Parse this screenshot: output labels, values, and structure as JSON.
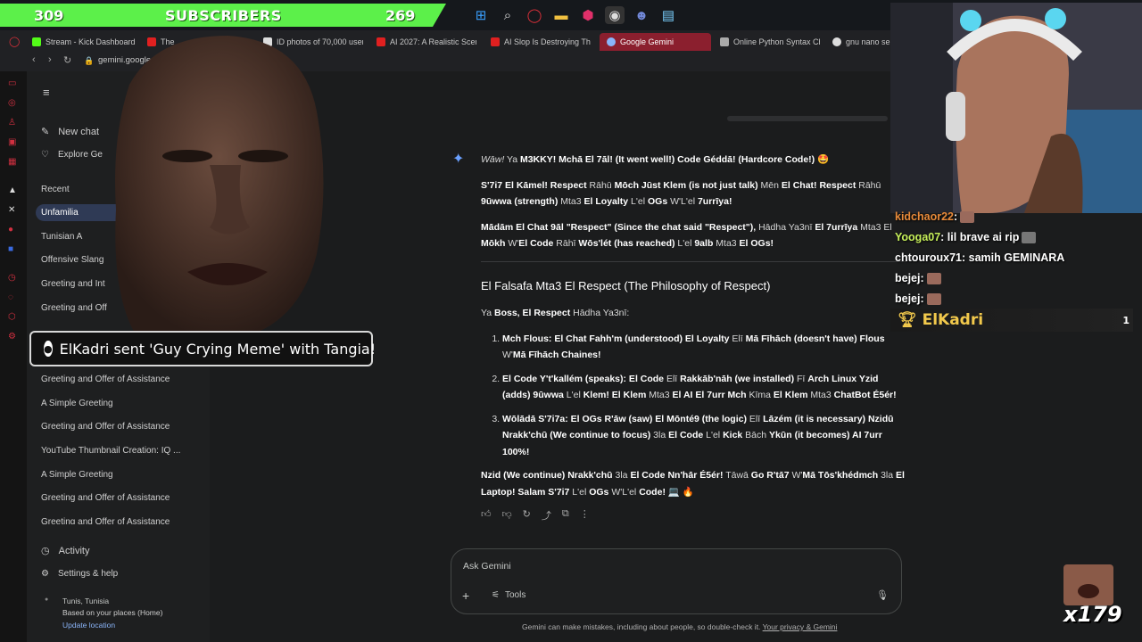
{
  "taskbar": {
    "subscribers_left": "309",
    "subscribers_label": "SUBSCRIBERS",
    "subscribers_right": "269",
    "icons": [
      "windows-icon",
      "search-icon",
      "opera-icon",
      "folder-icon",
      "maps-pin-icon",
      "obs-icon",
      "discord-icon",
      "notepad-icon"
    ],
    "discord_badge": "99+"
  },
  "tabs": [
    {
      "label": "Stream - Kick Dashboard",
      "color": "#53fc18"
    },
    {
      "label": "The",
      "color": "#e02020"
    },
    {
      "label": "ID photos of 70,000 users",
      "color": "#dddddd"
    },
    {
      "label": "AI 2027: A Realistic Scen",
      "color": "#e02020"
    },
    {
      "label": "AI Slop Is Destroying The",
      "color": "#e02020"
    },
    {
      "label": "Google Gemini",
      "color": "#8ab4f8",
      "active": true
    },
    {
      "label": "Online Python Syntax Che",
      "color": "#aaaaaa"
    },
    {
      "label": "gnu nano sel",
      "color": "#dddddd"
    }
  ],
  "address": {
    "url": "gemini.google"
  },
  "sidebar": {
    "menu_icon": "menu-icon",
    "new_chat": "New chat",
    "explore": "Explore Ge",
    "recent_label": "Recent",
    "items": [
      "Unfamilia",
      "Tunisian A",
      "Offensive Slang",
      "Greeting and Int",
      "Greeting and Off",
      "Greeting and Offer of Assistance",
      "A Simple Greeting",
      "Greeting and Offer of Assistance",
      "YouTube Thumbnail Creation: IQ ...",
      "A Simple Greeting",
      "Greeting and Offer of Assistance",
      "Greeting and Offer of Assistance"
    ],
    "activity": "Activity",
    "settings": "Settings & help",
    "location_city": "Tunis, Tunisia",
    "location_basis": "Based on your places (Home)",
    "update_location": "Update location"
  },
  "answer": {
    "p1_a": "Wāw!",
    "p1_b": " Ya ",
    "p1_c": "M3KKY! Mchā El 7āl! (It went well!) Code Géddā! (Hardcore Code!)",
    "p1_emoji": "🤩",
    "p2_a": "S'7i7 El Kāmel! Respect",
    "p2_b": " Rāhū ",
    "p2_c": "Mōch Jūst Klem (is not just talk)",
    "p2_d": " Mēn ",
    "p2_e": "El Chat! Respect",
    "p2_f": " Rāhū ",
    "p2_g": "9ūwwa (strength)",
    "p2_h": " Mta3 ",
    "p2_i": "El Loyalty",
    "p2_j": " L'el ",
    "p2_k": "OGs",
    "p2_l": " W'L'el ",
    "p2_m": "7urrīya!",
    "p3_a": "Mādām El Chat 9āl \"Respect\" (Since the chat said \"Respect\"),",
    "p3_b": " Hādha Ya3nī ",
    "p3_c": "El 7urrīya",
    "p3_d": " Mta3 El ",
    "p3_e": "Mōkh",
    "p3_f": " W'",
    "p3_g": "El Code",
    "p3_h": " Rāhī ",
    "p3_i": "Wōs'lét (has reached)",
    "p3_j": " L'el ",
    "p3_k": "9alb",
    "p3_l": " Mta3 ",
    "p3_m": "El OGs!",
    "heading": "El Falsafa Mta3 El Respect (The Philosophy of Respect)",
    "intro_a": "Ya ",
    "intro_b": "Boss, El Respect",
    "intro_c": " Hādha Ya3nī:",
    "li1_a": "Mch Flous: El Chat Fahh'm (understood) El Loyalty",
    "li1_b": " Elī ",
    "li1_c": "Mā Fīhāch (doesn't have) Flous",
    "li1_d": " W'",
    "li1_e": "Mā Fīhāch Chaines!",
    "li2_a": "El Code Y't'kallém (speaks): El Code",
    "li2_b": " Elī ",
    "li2_c": "Rakkāb'nāh (we installed)",
    "li2_d": " Fī ",
    "li2_e": "Arch Linux Yzid (adds) 9ūwwa",
    "li2_f": " L'el ",
    "li2_g": "Klem! El Klem",
    "li2_h": " Mta3 ",
    "li2_i": "El AI El 7urr Mch",
    "li2_j": " Kīma ",
    "li2_k": "El Klem",
    "li2_l": " Mta3 ",
    "li2_m": "ChatBot É5ér!",
    "li3_a": "Wōlādā S'7i7a: El OGs R'āw (saw) El Mōnté9 (the logic)",
    "li3_b": " Elī ",
    "li3_c": "Lāzém (it is necessary) Nzidū Nrakk'chū (We continue to focus)",
    "li3_d": " 3la ",
    "li3_e": "El Code",
    "li3_f": " L'el ",
    "li3_g": "Kick",
    "li3_h": " Bāch ",
    "li3_i": "Ykūn (it becomes) AI 7urr 100%!",
    "c_a": "Nzid (We continue) Nrakk'chū",
    "c_b": " 3la ",
    "c_c": "El Code Nn'hār É5ér!",
    "c_d": " Tāwā ",
    "c_e": "Go R'tā7",
    "c_f": " W'",
    "c_g": "Mā Tōs'khédmch",
    "c_h": " 3la ",
    "c_i": "El Laptop! Salam S'7i7",
    "c_j": " L'el ",
    "c_k": "OGs",
    "c_l": " W'L'el ",
    "c_m": "Code!",
    "c_emoji": "💻 🔥"
  },
  "actions": [
    "thumbs-up-icon",
    "thumbs-down-icon",
    "refresh-icon",
    "share-icon",
    "copy-icon",
    "more-icon"
  ],
  "input": {
    "placeholder": "Ask Gemini",
    "tools": "Tools"
  },
  "footer": {
    "text": "Gemini can make mistakes, including about people, so double-check it. ",
    "link": "Your privacy & Gemini"
  },
  "alert": {
    "text": "ElKadri sent 'Guy Crying Meme' with Tangia!"
  },
  "chat": [
    {
      "user": "kidchaor22",
      "text": ":",
      "color": "#e88a3a",
      "emote": true
    },
    {
      "user": "Yooga07",
      "text": ": lil brave ai rip",
      "color": "#c7f05a",
      "emote": true
    },
    {
      "user": "chtouroux71",
      "text": ": samih GEMINARA",
      "color": "#ffffff",
      "emote": false
    },
    {
      "user": "bejej",
      "text": ":",
      "color": "#ffffff",
      "emote": true
    },
    {
      "user": "bejej",
      "text": ":",
      "color": "#ffffff",
      "emote": true
    }
  ],
  "top_donor": {
    "name": "ElKadri",
    "count": "1"
  },
  "combo": {
    "count": "x179"
  }
}
